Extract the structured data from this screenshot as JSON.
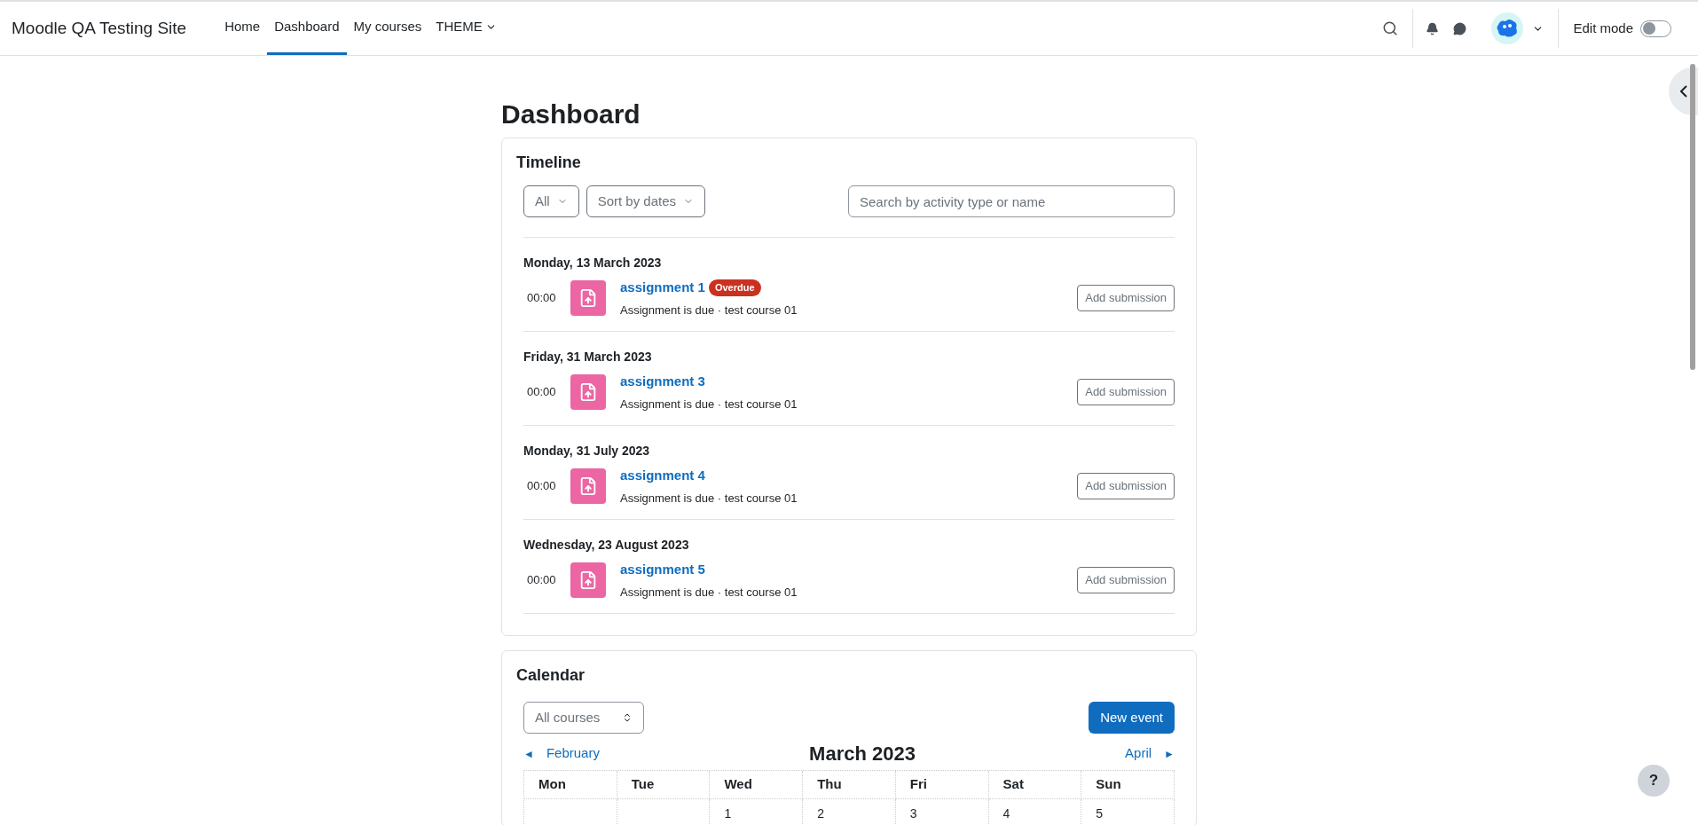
{
  "site_name": "Moodle QA Testing Site",
  "nav": [
    {
      "label": "Home",
      "selected": false,
      "kind": "link"
    },
    {
      "label": "Dashboard",
      "selected": true,
      "kind": "link"
    },
    {
      "label": "My courses",
      "selected": false,
      "kind": "link"
    },
    {
      "label": "THEME",
      "selected": false,
      "kind": "dropdown"
    }
  ],
  "edit_mode": {
    "label": "Edit mode",
    "on": false
  },
  "page_title": "Dashboard",
  "timeline": {
    "title": "Timeline",
    "filter": "All",
    "sort": "Sort by dates",
    "search_placeholder": "Search by activity type or name",
    "groups": [
      {
        "date": "Monday, 13 March 2023",
        "events": [
          {
            "time": "00:00",
            "name": "assignment 1",
            "badge": "Overdue",
            "detail": "Assignment is due · test course 01",
            "action": "Add submission"
          }
        ]
      },
      {
        "date": "Friday, 31 March 2023",
        "events": [
          {
            "time": "00:00",
            "name": "assignment 3",
            "detail": "Assignment is due · test course 01",
            "action": "Add submission"
          }
        ]
      },
      {
        "date": "Monday, 31 July 2023",
        "events": [
          {
            "time": "00:00",
            "name": "assignment 4",
            "detail": "Assignment is due · test course 01",
            "action": "Add submission"
          }
        ]
      },
      {
        "date": "Wednesday, 23 August 2023",
        "events": [
          {
            "time": "00:00",
            "name": "assignment 5",
            "detail": "Assignment is due · test course 01",
            "action": "Add submission"
          }
        ]
      }
    ]
  },
  "calendar": {
    "title": "Calendar",
    "course_select": "All courses",
    "new_event": "New event",
    "prev": "February",
    "month": "March 2023",
    "next": "April",
    "prev_icon": "◄",
    "next_icon": "►",
    "weekdays": [
      "Mon",
      "Tue",
      "Wed",
      "Thu",
      "Fri",
      "Sat",
      "Sun"
    ],
    "week_1": [
      {
        "kind": "empty"
      },
      {
        "kind": "empty"
      },
      {
        "kind": "day",
        "day": "1"
      },
      {
        "kind": "day",
        "day": "2"
      },
      {
        "kind": "day",
        "day": "3"
      },
      {
        "kind": "day",
        "day": "4"
      },
      {
        "kind": "day",
        "day": "5"
      }
    ]
  },
  "help_button": "?"
}
